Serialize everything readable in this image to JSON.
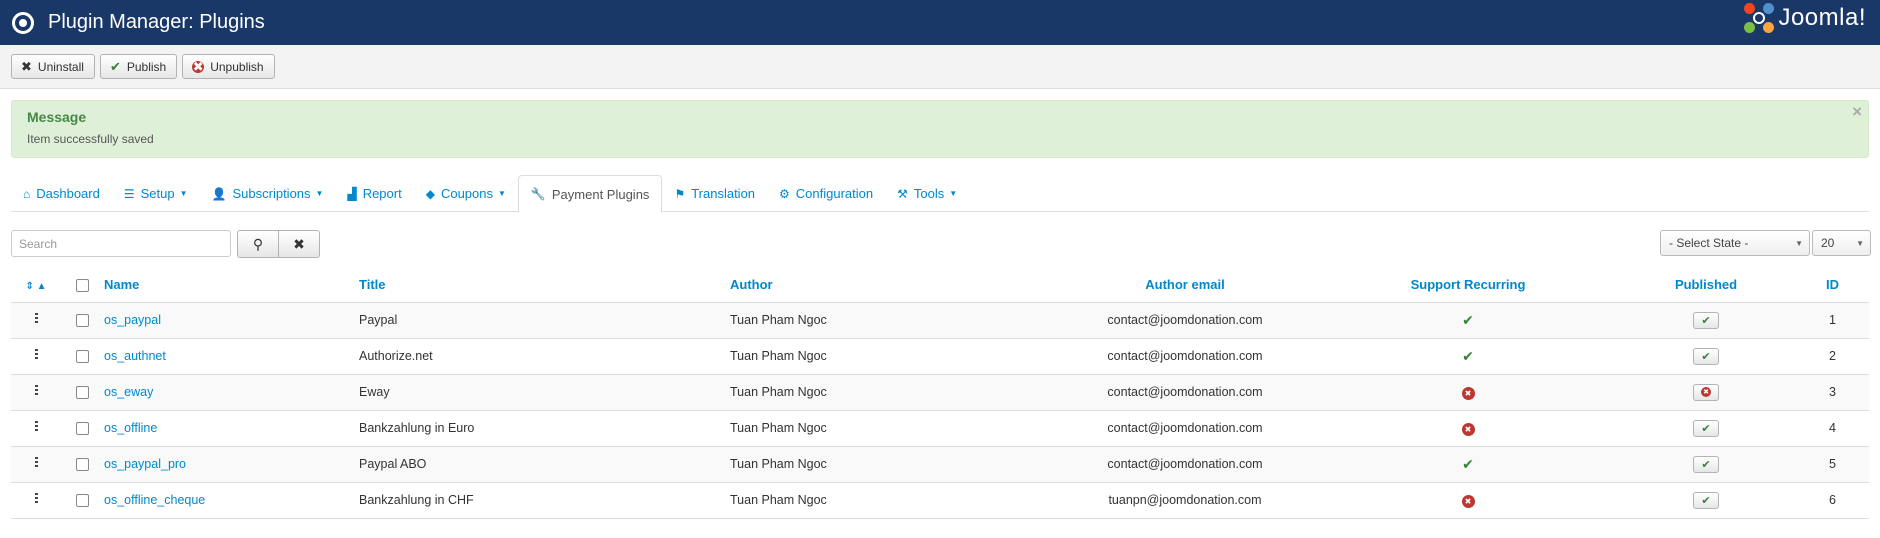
{
  "header": {
    "title": "Plugin Manager: Plugins",
    "brand": "Joomla!"
  },
  "toolbar": {
    "uninstall": "Uninstall",
    "publish": "Publish",
    "unpublish": "Unpublish"
  },
  "alert": {
    "heading": "Message",
    "text": "Item successfully saved",
    "close": "×"
  },
  "tabs": [
    {
      "label": "Dashboard",
      "icon": "home-icon"
    },
    {
      "label": "Setup",
      "icon": "list-icon",
      "dropdown": true
    },
    {
      "label": "Subscriptions",
      "icon": "user-icon",
      "dropdown": true
    },
    {
      "label": "Report",
      "icon": "chart-icon"
    },
    {
      "label": "Coupons",
      "icon": "tag-icon",
      "dropdown": true
    },
    {
      "label": "Payment Plugins",
      "icon": "wrench-icon",
      "active": true
    },
    {
      "label": "Translation",
      "icon": "flag-icon"
    },
    {
      "label": "Configuration",
      "icon": "gear-icon"
    },
    {
      "label": "Tools",
      "icon": "tools-icon",
      "dropdown": true
    }
  ],
  "filters": {
    "search_placeholder": "Search",
    "state_select": "- Select State -",
    "limit_select": "20"
  },
  "table": {
    "headers": {
      "name": "Name",
      "title": "Title",
      "author": "Author",
      "email": "Author email",
      "recurring": "Support Recurring",
      "published": "Published",
      "id": "ID"
    },
    "rows": [
      {
        "name": "os_paypal",
        "title": "Paypal",
        "author": "Tuan Pham Ngoc",
        "email": "contact@joomdonation.com",
        "recurring": true,
        "published": true,
        "id": "1"
      },
      {
        "name": "os_authnet",
        "title": "Authorize.net",
        "author": "Tuan Pham Ngoc",
        "email": "contact@joomdonation.com",
        "recurring": true,
        "published": true,
        "id": "2"
      },
      {
        "name": "os_eway",
        "title": "Eway",
        "author": "Tuan Pham Ngoc",
        "email": "contact@joomdonation.com",
        "recurring": false,
        "published": false,
        "id": "3"
      },
      {
        "name": "os_offline",
        "title": "Bankzahlung in Euro",
        "author": "Tuan Pham Ngoc",
        "email": "contact@joomdonation.com",
        "recurring": false,
        "published": true,
        "id": "4"
      },
      {
        "name": "os_paypal_pro",
        "title": "Paypal ABO",
        "author": "Tuan Pham Ngoc",
        "email": "contact@joomdonation.com",
        "recurring": true,
        "published": true,
        "id": "5"
      },
      {
        "name": "os_offline_cheque",
        "title": "Bankzahlung in CHF",
        "author": "Tuan Pham Ngoc",
        "email": "tuanpn@joomdonation.com",
        "recurring": false,
        "published": true,
        "id": "6"
      }
    ]
  },
  "colors": {
    "header_bg": "#1a3867",
    "link": "#0088cc",
    "success": "#378137",
    "danger": "#bd362f"
  }
}
